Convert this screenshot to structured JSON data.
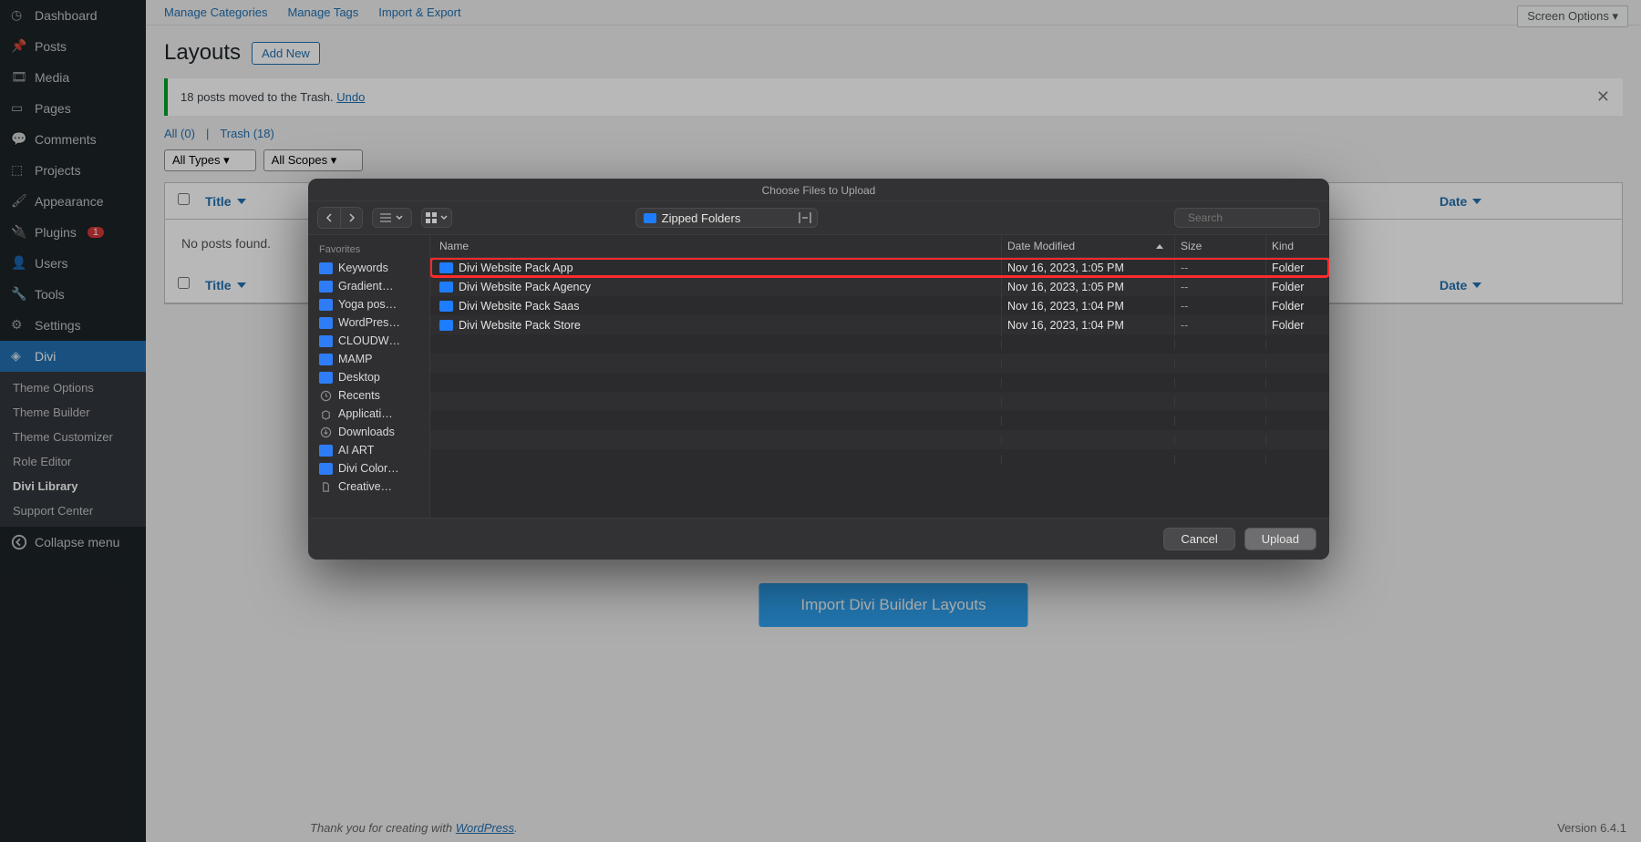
{
  "wp": {
    "screen_options": "Screen Options ▾",
    "sidebar": [
      {
        "label": "Dashboard"
      },
      {
        "label": "Posts"
      },
      {
        "label": "Media"
      },
      {
        "label": "Pages"
      },
      {
        "label": "Comments"
      },
      {
        "label": "Projects"
      },
      {
        "label": "Appearance"
      },
      {
        "label": "Plugins",
        "badge": "1"
      },
      {
        "label": "Users"
      },
      {
        "label": "Tools"
      },
      {
        "label": "Settings"
      },
      {
        "label": "Divi",
        "active": true
      }
    ],
    "subnav": [
      "Theme Options",
      "Theme Builder",
      "Theme Customizer",
      "Role Editor",
      "Divi Library",
      "Support Center"
    ],
    "subnav_active": "Divi Library",
    "collapse": "Collapse menu",
    "topnav": [
      "Manage Categories",
      "Manage Tags",
      "Import & Export"
    ],
    "page_title": "Layouts",
    "add_new": "Add New",
    "notice_text": "18 posts moved to the Trash. ",
    "notice_link": "Undo",
    "filter_all": "All (0)",
    "filter_trash": "Trash (18)",
    "dropdowns": [
      "All Types ▾",
      "All Scopes ▾"
    ],
    "th_title": "Title",
    "th_date": "Date",
    "empty": "No posts found.",
    "import_btn": "Import Divi Builder Layouts",
    "footer_thank": "Thank you for creating with ",
    "footer_link": "WordPress",
    "version": "Version 6.4.1"
  },
  "chooser": {
    "title": "Choose Files to Upload",
    "location": "Zipped Folders",
    "search_placeholder": "Search",
    "favorites_header": "Favorites",
    "favorites": [
      "Keywords",
      "Gradient…",
      "Yoga pos…",
      "WordPres…",
      "CLOUDW…",
      "MAMP",
      "Desktop",
      "Recents",
      "Applicati…",
      "Downloads",
      "AI ART",
      "Divi Color…",
      "Creative…"
    ],
    "cols": {
      "name": "Name",
      "date": "Date Modified",
      "size": "Size",
      "kind": "Kind"
    },
    "rows": [
      {
        "name": "Divi Website Pack App",
        "date": "Nov 16, 2023, 1:05 PM",
        "size": "--",
        "kind": "Folder",
        "selected": true
      },
      {
        "name": "Divi Website Pack Agency",
        "date": "Nov 16, 2023, 1:05 PM",
        "size": "--",
        "kind": "Folder"
      },
      {
        "name": "Divi Website Pack Saas",
        "date": "Nov 16, 2023, 1:04 PM",
        "size": "--",
        "kind": "Folder"
      },
      {
        "name": "Divi Website Pack Store",
        "date": "Nov 16, 2023, 1:04 PM",
        "size": "--",
        "kind": "Folder"
      }
    ],
    "cancel": "Cancel",
    "upload": "Upload"
  }
}
